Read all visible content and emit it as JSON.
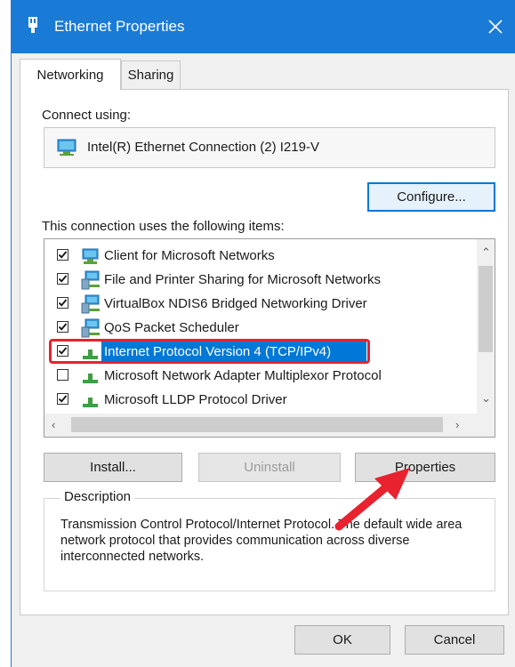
{
  "window": {
    "title": "Ethernet Properties",
    "close_glyph": "✕",
    "titlebar_color": "#1a7bd6"
  },
  "tabs": [
    {
      "label": "Networking",
      "active": true
    },
    {
      "label": "Sharing",
      "active": false
    }
  ],
  "connect": {
    "label": "Connect using:",
    "adapter": "Intel(R) Ethernet Connection (2) I219-V",
    "adapter_icon": "network-adapter-icon",
    "configure_button": "Configure..."
  },
  "items": {
    "label": "This connection uses the following items:",
    "list": [
      {
        "label": "Client for Microsoft Networks",
        "checked": true,
        "icon": "network-client-icon",
        "selected": false
      },
      {
        "label": "File and Printer Sharing for Microsoft Networks",
        "checked": true,
        "icon": "network-service-icon",
        "selected": false
      },
      {
        "label": "VirtualBox NDIS6 Bridged Networking Driver",
        "checked": true,
        "icon": "network-service-icon",
        "selected": false
      },
      {
        "label": "QoS Packet Scheduler",
        "checked": true,
        "icon": "network-service-icon",
        "selected": false
      },
      {
        "label": "Internet Protocol Version 4 (TCP/IPv4)",
        "checked": true,
        "icon": "protocol-icon",
        "selected": true
      },
      {
        "label": "Microsoft Network Adapter Multiplexor Protocol",
        "checked": false,
        "icon": "protocol-icon",
        "selected": false
      },
      {
        "label": "Microsoft LLDP Protocol Driver",
        "checked": true,
        "icon": "protocol-icon",
        "selected": false
      }
    ]
  },
  "buttons": {
    "install": "Install...",
    "uninstall": "Uninstall",
    "properties": "Properties",
    "ok": "OK",
    "cancel": "Cancel"
  },
  "description": {
    "legend": "Description",
    "text": "Transmission Control Protocol/Internet Protocol. The default wide area network protocol that provides communication across diverse interconnected networks."
  },
  "colors": {
    "selection": "#0078d7",
    "annotation_red": "#e8222e"
  }
}
